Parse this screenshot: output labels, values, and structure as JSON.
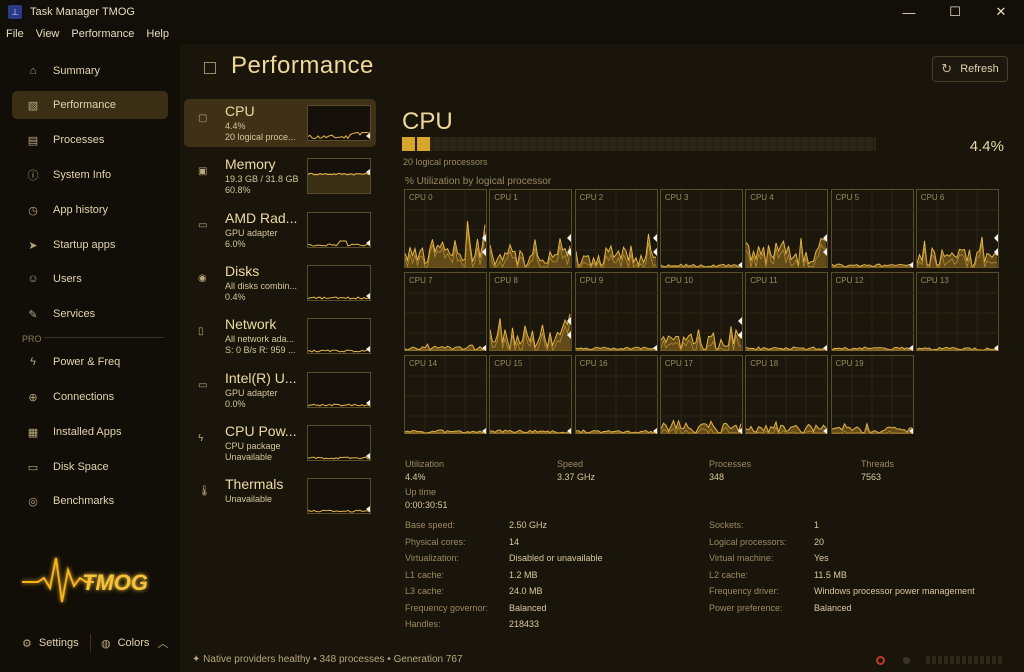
{
  "window": {
    "title": "Task Manager TMOG",
    "controls": [
      "—",
      "☐",
      "✕"
    ]
  },
  "menu": [
    "File",
    "View",
    "Performance",
    "Help"
  ],
  "sidebar": {
    "items": [
      {
        "label": "Summary",
        "icon": "home-icon",
        "glyph": "⌂"
      },
      {
        "label": "Performance",
        "icon": "performance-icon",
        "glyph": "▧"
      },
      {
        "label": "Processes",
        "icon": "processes-icon",
        "glyph": "▤"
      },
      {
        "label": "System Info",
        "icon": "info-icon",
        "glyph": "ⓘ"
      },
      {
        "label": "App history",
        "icon": "history-icon",
        "glyph": "◷"
      },
      {
        "label": "Startup apps",
        "icon": "startup-icon",
        "glyph": "➤"
      },
      {
        "label": "Users",
        "icon": "users-icon",
        "glyph": "☺"
      },
      {
        "label": "Services",
        "icon": "services-icon",
        "glyph": "✎"
      }
    ],
    "pro_label": "PRO",
    "pro_items": [
      {
        "label": "Power & Freq",
        "icon": "power-icon",
        "glyph": "ϟ"
      },
      {
        "label": "Connections",
        "icon": "connections-icon",
        "glyph": "⊕"
      },
      {
        "label": "Installed Apps",
        "icon": "installed-apps-icon",
        "glyph": "▦"
      },
      {
        "label": "Disk Space",
        "icon": "disk-space-icon",
        "glyph": "▭"
      },
      {
        "label": "Benchmarks",
        "icon": "benchmarks-icon",
        "glyph": "◎"
      }
    ],
    "settings_label": "Settings",
    "colors_label": "Colors"
  },
  "logo_text": "TMOG",
  "page": {
    "title": "Performance",
    "refresh_label": "Refresh"
  },
  "devices": [
    {
      "name": "CPU",
      "line1": "4.4%",
      "line2": "20 logical proce...",
      "icon": "cpu-chip-icon",
      "glyph": "▢"
    },
    {
      "name": "Memory",
      "line1": "19.3 GB / 31.8 GB",
      "line2": "60.8%",
      "icon": "memory-icon",
      "glyph": "▣"
    },
    {
      "name": "AMD Rad...",
      "line1": "GPU adapter",
      "line2": "6.0%",
      "icon": "gpu-icon",
      "glyph": "▭"
    },
    {
      "name": "Disks",
      "line1": "All disks combin...",
      "line2": "0.4%",
      "icon": "disk-icon",
      "glyph": "◉"
    },
    {
      "name": "Network",
      "line1": "All network ada...",
      "line2": "S: 0 B/s  R: 959 ...",
      "icon": "network-icon",
      "glyph": "▯"
    },
    {
      "name": "Intel(R) U...",
      "line1": "GPU adapter",
      "line2": "0.0%",
      "icon": "gpu-icon",
      "glyph": "▭"
    },
    {
      "name": "CPU Pow...",
      "line1": "CPU package",
      "line2": "Unavailable",
      "icon": "power-icon",
      "glyph": "ϟ"
    },
    {
      "name": "Thermals",
      "line1": "Unavailable",
      "line2": "",
      "icon": "thermometer-icon",
      "glyph": "🌡"
    }
  ],
  "cpu": {
    "title": "CPU",
    "logical_label": "20 logical processors",
    "percent_text": "4.4%",
    "usage_fraction": 0.044,
    "util_label": "% Utilization by logical processor",
    "accent": "#d9a42a",
    "cores": [
      "CPU 0",
      "CPU 1",
      "CPU 2",
      "CPU 3",
      "CPU 4",
      "CPU 5",
      "CPU 6",
      "CPU 7",
      "CPU 8",
      "CPU 9",
      "CPU 10",
      "CPU 11",
      "CPU 12",
      "CPU 13",
      "CPU 14",
      "CPU 15",
      "CPU 16",
      "CPU 17",
      "CPU 18",
      "CPU 19"
    ]
  },
  "stats": {
    "utilization": {
      "label": "Utilization",
      "value": "4.4%"
    },
    "speed": {
      "label": "Speed",
      "value": "3.37 GHz"
    },
    "processes": {
      "label": "Processes",
      "value": "348"
    },
    "threads": {
      "label": "Threads",
      "value": "7563"
    },
    "uptime": {
      "label": "Up time",
      "value": "0:00:30:51"
    }
  },
  "details_left": [
    {
      "k": "Base speed:",
      "v": "2.50 GHz"
    },
    {
      "k": "Physical cores:",
      "v": "14"
    },
    {
      "k": "Virtualization:",
      "v": "Disabled or unavailable"
    },
    {
      "k": "L1 cache:",
      "v": "1.2 MB"
    },
    {
      "k": "L3 cache:",
      "v": "24.0 MB"
    },
    {
      "k": "Frequency governor:",
      "v": "Balanced"
    },
    {
      "k": "Handles:",
      "v": "218433"
    }
  ],
  "details_right": [
    {
      "k": "Sockets:",
      "v": "1"
    },
    {
      "k": "Logical processors:",
      "v": "20"
    },
    {
      "k": "Virtual machine:",
      "v": "Yes"
    },
    {
      "k": "L2 cache:",
      "v": "11.5 MB"
    },
    {
      "k": "Frequency driver:",
      "v": "Windows processor power management"
    },
    {
      "k": "Power preference:",
      "v": "Balanced"
    }
  ],
  "status": {
    "text": "✦  Native providers healthy  •  348 processes  •  Generation 767"
  }
}
